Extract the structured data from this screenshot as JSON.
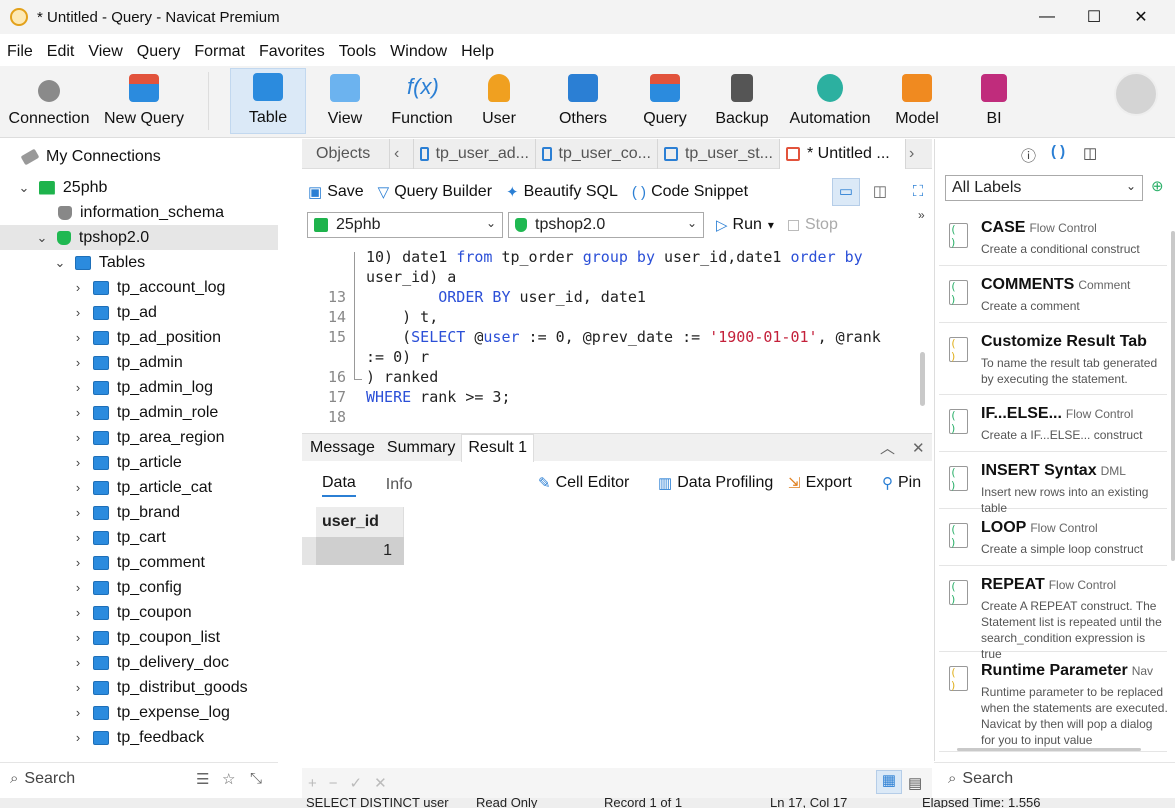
{
  "window": {
    "title": "* Untitled - Query - Navicat Premium",
    "minimize": "—",
    "maximize": "☐",
    "close": "✕"
  },
  "menu": [
    "File",
    "Edit",
    "View",
    "Query",
    "Format",
    "Favorites",
    "Tools",
    "Window",
    "Help"
  ],
  "toolbar": [
    {
      "label": "Connection",
      "icon": "connection-icon",
      "color": "#777"
    },
    {
      "label": "New Query",
      "icon": "new-query-icon",
      "color": "#e2533c"
    },
    {
      "label": "Table",
      "icon": "table-icon",
      "color": "#2b8bde"
    },
    {
      "label": "View",
      "icon": "view-icon",
      "color": "#2b8bde"
    },
    {
      "label": "Function",
      "icon": "function-icon",
      "color": "#2b8bde"
    },
    {
      "label": "User",
      "icon": "user-icon",
      "color": "#f0a020"
    },
    {
      "label": "Others",
      "icon": "others-icon",
      "color": "#2b7fd4"
    },
    {
      "label": "Query",
      "icon": "query-icon",
      "color": "#e2533c"
    },
    {
      "label": "Backup",
      "icon": "backup-icon",
      "color": "#555"
    },
    {
      "label": "Automation",
      "icon": "automation-icon",
      "color": "#2cb0a0"
    },
    {
      "label": "Model",
      "icon": "model-icon",
      "color": "#f08a20"
    },
    {
      "label": "BI",
      "icon": "bi-icon",
      "color": "#c02c7c"
    }
  ],
  "tree": {
    "root": "My Connections",
    "connection": "25phb",
    "db1": "information_schema",
    "db2": "tpshop2.0",
    "tables_label": "Tables",
    "tables": [
      "tp_account_log",
      "tp_ad",
      "tp_ad_position",
      "tp_admin",
      "tp_admin_log",
      "tp_admin_role",
      "tp_area_region",
      "tp_article",
      "tp_article_cat",
      "tp_brand",
      "tp_cart",
      "tp_comment",
      "tp_config",
      "tp_coupon",
      "tp_coupon_list",
      "tp_delivery_doc",
      "tp_distribut_goods",
      "tp_expense_log",
      "tp_feedback"
    ]
  },
  "left_search": "Search",
  "tabs": [
    "Objects",
    "tp_user_ad...",
    "tp_user_co...",
    "tp_user_st...",
    "* Untitled ..."
  ],
  "query_toolbar": {
    "save": "Save",
    "builder": "Query Builder",
    "beautify": "Beautify SQL",
    "snippet": "Code Snippet"
  },
  "selectors": {
    "connection": "25phb",
    "database": "tpshop2.0",
    "run": "Run",
    "stop": "Stop"
  },
  "editor_lines": [
    {
      "n": "",
      "code": "10) date1 from tp_order group by user_id,date1 order by"
    },
    {
      "n": "",
      "code": "user_id) a"
    },
    {
      "n": "13",
      "code": "        ORDER BY user_id, date1"
    },
    {
      "n": "14",
      "code": "    ) t,"
    },
    {
      "n": "15",
      "code": "    (SELECT @user := 0, @prev_date := '1900-01-01', @rank"
    },
    {
      "n": "",
      "code": ":= 0) r"
    },
    {
      "n": "16",
      "code": ") ranked"
    },
    {
      "n": "17",
      "code": "WHERE rank >= 3;"
    },
    {
      "n": "18",
      "code": ""
    }
  ],
  "result_tabs": [
    "Message",
    "Summary",
    "Result 1"
  ],
  "result_sub": {
    "data": "Data",
    "info": "Info",
    "cell_editor": "Cell Editor",
    "profiling": "Data Profiling",
    "export": "Export",
    "pin": "Pin"
  },
  "grid": {
    "columns": [
      "user_id"
    ],
    "rows": [
      [
        "1"
      ]
    ]
  },
  "status": {
    "sql": "SELECT DISTINCT user",
    "mode": "Read Only",
    "records": "Record 1 of 1",
    "pos": "Ln 17, Col 17",
    "time": "Elapsed Time: 1.556"
  },
  "right_panel": {
    "filter": "All Labels",
    "snippets": [
      {
        "name": "CASE",
        "tag": "Flow Control",
        "desc": "Create a conditional construct"
      },
      {
        "name": "COMMENTS",
        "tag": "Comment",
        "desc": "Create a comment"
      },
      {
        "name": "Customize Result Tab",
        "tag": "",
        "desc": "To name the result tab generated by executing the statement."
      },
      {
        "name": "IF...ELSE...",
        "tag": "Flow Control",
        "desc": "Create a IF...ELSE... construct"
      },
      {
        "name": "INSERT Syntax",
        "tag": "DML",
        "desc": "Insert new rows into an existing table"
      },
      {
        "name": "LOOP",
        "tag": "Flow Control",
        "desc": "Create a simple loop construct"
      },
      {
        "name": "REPEAT",
        "tag": "Flow Control",
        "desc": "Create A REPEAT construct. The Statement list is repeated until the search_condition expression is true"
      },
      {
        "name": "Runtime Parameter",
        "tag": "Nav",
        "desc": "Runtime parameter to be replaced when the statements are executed. Navicat by then will pop a dialog for you to input value"
      }
    ],
    "search": "Search"
  }
}
